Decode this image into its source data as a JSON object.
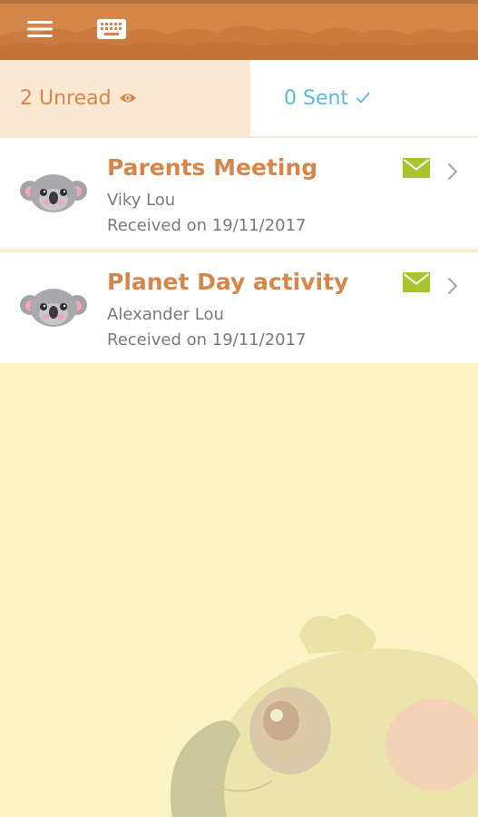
{
  "header": {
    "menu_icon": "hamburger-menu-icon",
    "keyboard_icon": "keyboard-icon",
    "bar_color": "#d4874a"
  },
  "tabs": {
    "unread": {
      "label": "2 Unread",
      "icon": "eye-icon",
      "color": "#d4874a"
    },
    "sent": {
      "label": "0 Sent",
      "icon": "checkmark-icon",
      "color": "#5fb8d6"
    }
  },
  "messages": [
    {
      "subject": "Parents Meeting",
      "sender": "Viky Lou",
      "received": "Received on 19/11/2017",
      "status_icon": "envelope-icon",
      "avatar": "koala-avatar"
    },
    {
      "subject": "Planet Day activity",
      "sender": "Alexander Lou",
      "received": "Received on 19/11/2017",
      "status_icon": "envelope-icon",
      "avatar": "koala-avatar"
    }
  ],
  "colors": {
    "accent_orange": "#d4874a",
    "accent_blue": "#5fb8d6",
    "envelope_green": "#a8c52e",
    "background": "#fbf3c3"
  }
}
